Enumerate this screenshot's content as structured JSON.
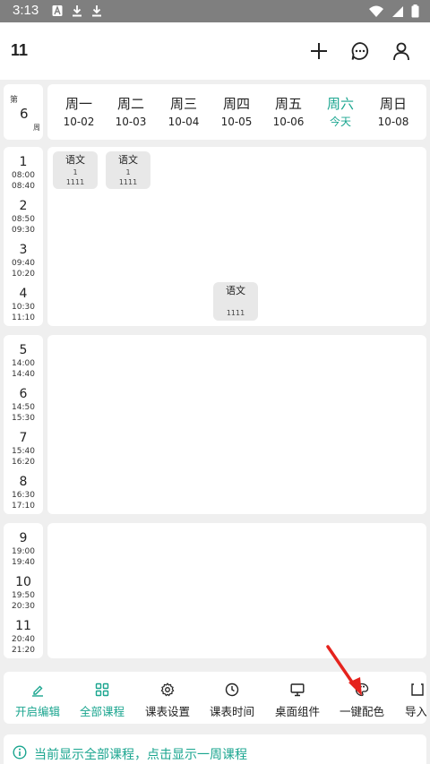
{
  "status_bar": {
    "time": "3:13"
  },
  "app_bar": {
    "title": "11"
  },
  "week": {
    "prefix": "第",
    "number": "6",
    "suffix": "周"
  },
  "days": [
    {
      "name": "周一",
      "date": "10-02",
      "today": false
    },
    {
      "name": "周二",
      "date": "10-03",
      "today": false
    },
    {
      "name": "周三",
      "date": "10-04",
      "today": false
    },
    {
      "name": "周四",
      "date": "10-05",
      "today": false
    },
    {
      "name": "周五",
      "date": "10-06",
      "today": false
    },
    {
      "name": "周六",
      "date": "今天",
      "today": true
    },
    {
      "name": "周日",
      "date": "10-08",
      "today": false
    }
  ],
  "periods": [
    {
      "num": "1",
      "start": "08:00",
      "end": "08:40"
    },
    {
      "num": "2",
      "start": "08:50",
      "end": "09:30"
    },
    {
      "num": "3",
      "start": "09:40",
      "end": "10:20"
    },
    {
      "num": "4",
      "start": "10:30",
      "end": "11:10"
    },
    {
      "num": "5",
      "start": "14:00",
      "end": "14:40"
    },
    {
      "num": "6",
      "start": "14:50",
      "end": "15:30"
    },
    {
      "num": "7",
      "start": "15:40",
      "end": "16:20"
    },
    {
      "num": "8",
      "start": "16:30",
      "end": "17:10"
    },
    {
      "num": "9",
      "start": "19:00",
      "end": "19:40"
    },
    {
      "num": "10",
      "start": "19:50",
      "end": "20:30"
    },
    {
      "num": "11",
      "start": "20:40",
      "end": "21:20"
    }
  ],
  "courses": [
    {
      "name": "语文",
      "room": "1",
      "teacher": "1111"
    },
    {
      "name": "语文",
      "room": "1",
      "teacher": "1111"
    },
    {
      "name": "语文",
      "room": "",
      "teacher": "1111"
    }
  ],
  "toolbar": [
    {
      "label": "开启编辑",
      "icon": "pencil-icon",
      "active": true
    },
    {
      "label": "全部课程",
      "icon": "grid-icon",
      "active": true
    },
    {
      "label": "课表设置",
      "icon": "gear-icon",
      "active": false
    },
    {
      "label": "课表时间",
      "icon": "clock-icon",
      "active": false
    },
    {
      "label": "桌面组件",
      "icon": "monitor-icon",
      "active": false
    },
    {
      "label": "一键配色",
      "icon": "palette-icon",
      "active": false
    },
    {
      "label": "导入",
      "icon": "import-icon",
      "active": false
    }
  ],
  "info": {
    "text": "当前显示全部课程，点击显示一周课程"
  },
  "colors": {
    "accent": "#1aa58f",
    "status_bar": "#7f7f7f",
    "background": "#efefef",
    "course_cell": "#e8e8e8",
    "arrow": "#e5231d"
  }
}
